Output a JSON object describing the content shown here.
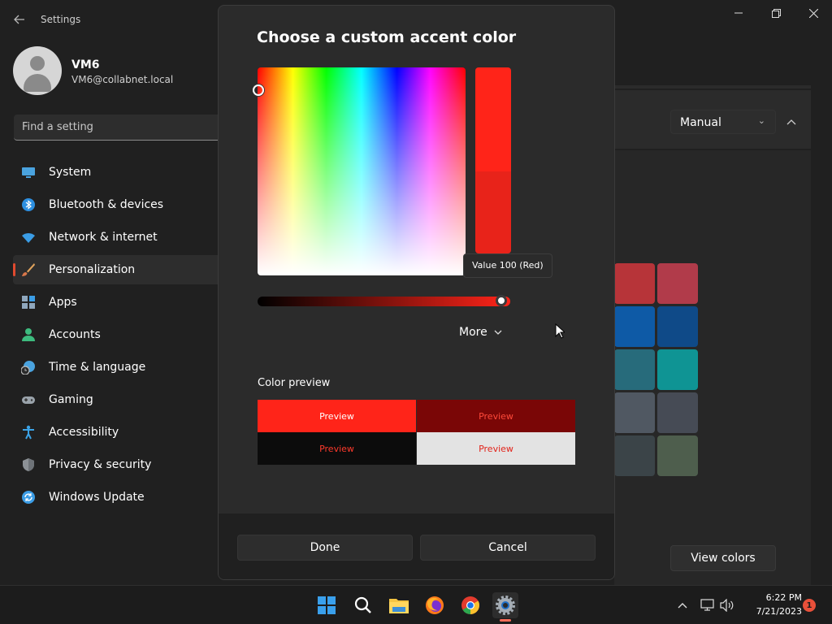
{
  "window": {
    "title": "Settings"
  },
  "user": {
    "name": "VM6",
    "email": "VM6@collabnet.local"
  },
  "search": {
    "placeholder": "Find a setting"
  },
  "sidebar": {
    "items": [
      {
        "label": "System",
        "icon": "system-icon",
        "color": "#4aa3df"
      },
      {
        "label": "Bluetooth & devices",
        "icon": "bluetooth-icon",
        "color": "#2d8fe0"
      },
      {
        "label": "Network & internet",
        "icon": "wifi-icon",
        "color": "#3b9de6"
      },
      {
        "label": "Personalization",
        "icon": "brush-icon",
        "color": "#e8a05a",
        "active": true
      },
      {
        "label": "Apps",
        "icon": "apps-icon",
        "color": "#8fa7bd"
      },
      {
        "label": "Accounts",
        "icon": "accounts-icon",
        "color": "#3dbb7e"
      },
      {
        "label": "Time & language",
        "icon": "clock-globe-icon",
        "color": "#4aa3df"
      },
      {
        "label": "Gaming",
        "icon": "gamepad-icon",
        "color": "#9aa3ab"
      },
      {
        "label": "Accessibility",
        "icon": "accessibility-icon",
        "color": "#3ba3e6"
      },
      {
        "label": "Privacy & security",
        "icon": "shield-icon",
        "color": "#8c9196"
      },
      {
        "label": "Windows Update",
        "icon": "update-icon",
        "color": "#3b9de6"
      }
    ]
  },
  "background": {
    "mode_dropdown": "Manual",
    "view_colors_label": "View colors",
    "swatches": [
      "#b73439",
      "#b13b4a",
      "#0e5aa6",
      "#0f4a88",
      "#276b7b",
      "#0f9494",
      "#505862",
      "#464b55",
      "#3b4448",
      "#4e5e4d"
    ]
  },
  "dialog": {
    "title": "Choose a custom accent color",
    "selected_color": "#ff2419",
    "current_color": "#e8231a",
    "value_tooltip": "Value 100 (Red)",
    "value_level": 1.0,
    "more_label": "More",
    "preview_label": "Color preview",
    "preview": [
      {
        "text": "Preview",
        "bg": "#ff2419",
        "fg": "#ffffff"
      },
      {
        "text": "Preview",
        "bg": "#7a0606",
        "fg": "#ff4a3a"
      },
      {
        "text": "Preview",
        "bg": "#0c0c0c",
        "fg": "#ff3a2c"
      },
      {
        "text": "Preview",
        "bg": "#e3e3e3",
        "fg": "#e2231a"
      }
    ],
    "done_label": "Done",
    "cancel_label": "Cancel"
  },
  "taskbar": {
    "apps": [
      {
        "name": "start-icon"
      },
      {
        "name": "search-icon"
      },
      {
        "name": "file-explorer-icon"
      },
      {
        "name": "firefox-icon"
      },
      {
        "name": "chrome-icon"
      },
      {
        "name": "settings-icon",
        "active": true
      }
    ],
    "time": "6:22 PM",
    "date": "7/21/2023",
    "notification_count": "1"
  }
}
